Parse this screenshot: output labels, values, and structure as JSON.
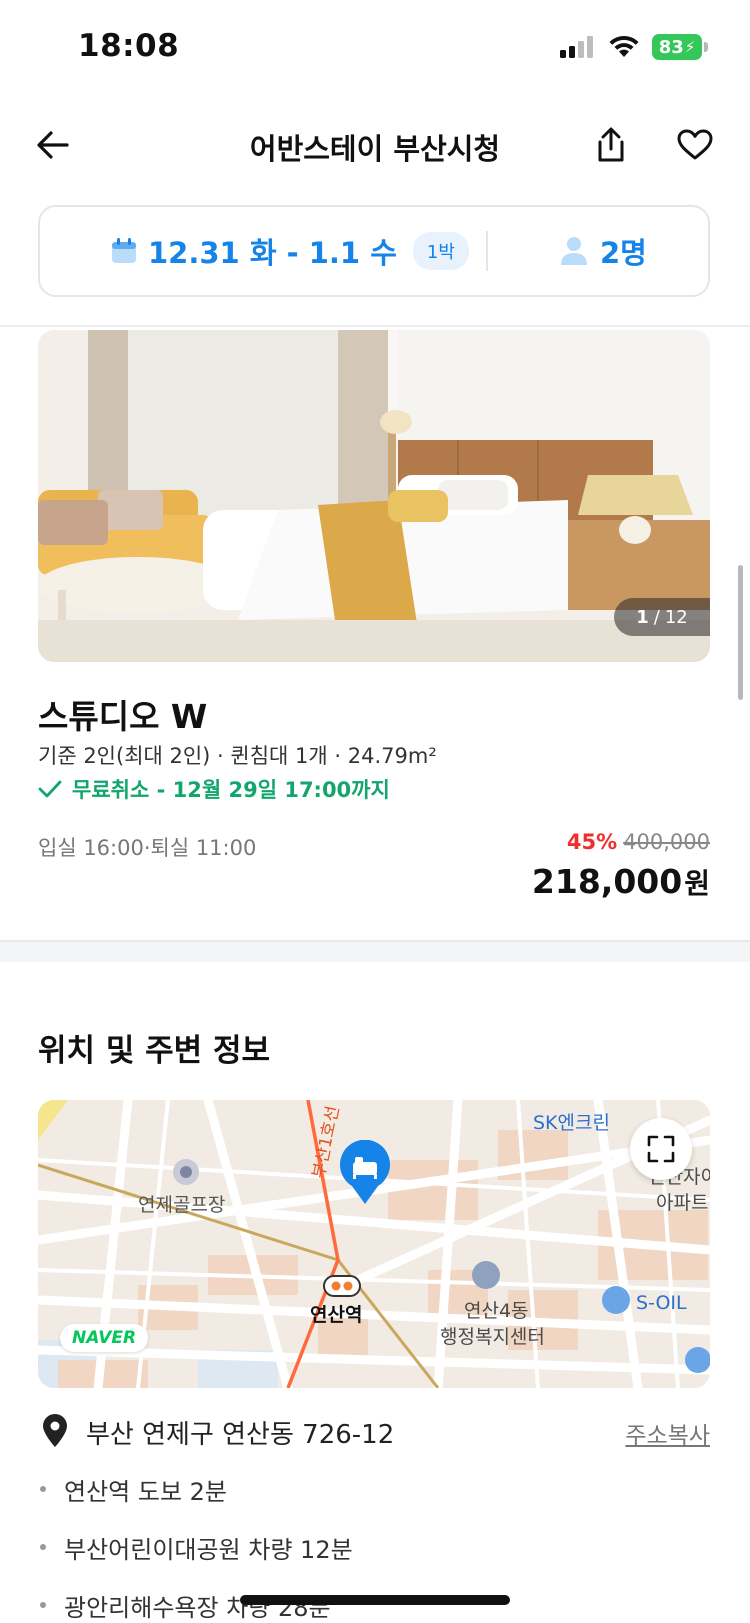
{
  "status_bar": {
    "time": "18:08",
    "battery": "83"
  },
  "header": {
    "title": "어반스테이 부산시청"
  },
  "booking": {
    "dates": "12.31 화 - 1.1 수",
    "nights": "1박",
    "guests": "2명"
  },
  "photo": {
    "current": "1",
    "separator": "/",
    "total": "12"
  },
  "room": {
    "name": "스튜디오 W",
    "spec": "기준 2인(최대 2인) · 퀸침대 1개 · 24.79m²",
    "cancellation": "무료취소 - 12월 29일 17:00까지",
    "check_in_out": "입실 16:00·퇴실 11:00",
    "discount": "45%",
    "original_price": "400,000",
    "price": "218,000",
    "currency": "원"
  },
  "location": {
    "title": "위치 및 주변 정보",
    "map_labels": {
      "sk": "SK엔크린",
      "apt_line1": "연산자이",
      "apt_line2": "아파트",
      "golf": "연제골프장",
      "road": "부산1호선",
      "station": "연산역",
      "center_line1": "연산4동",
      "center_line2": "행정복지센터",
      "soil": "S-OIL"
    },
    "map_provider": "NAVER",
    "address": "부산 연제구 연산동 726-12",
    "copy_label": "주소복사",
    "nearby": [
      "연산역 도보 2분",
      "부산어린이대공원 차량 12분",
      "광안리해수욕장 차량 28분"
    ]
  },
  "colors": {
    "accent": "#1583e8",
    "success": "#12a56e",
    "discount": "#f02e2e",
    "naver": "#03c75a"
  }
}
